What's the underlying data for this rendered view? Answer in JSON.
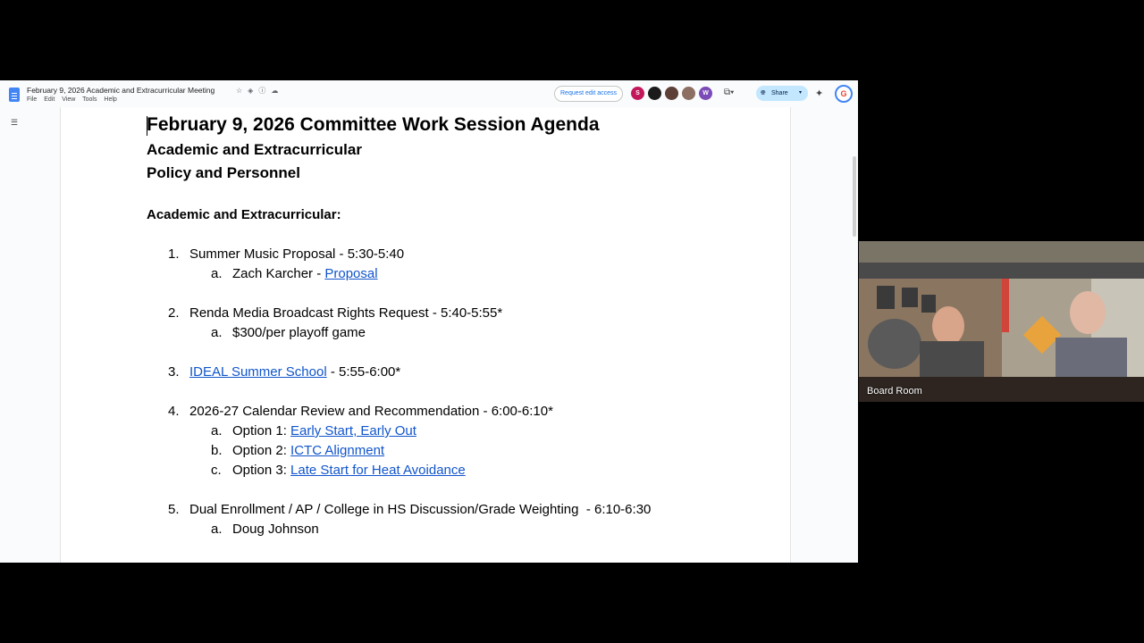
{
  "doc": {
    "title": "February 9, 2026 Academic and Extracurricular Meeting",
    "menu": [
      "File",
      "Edit",
      "View",
      "Tools",
      "Help"
    ],
    "request_edit_label": "Request edit access",
    "avatars": [
      {
        "letter": "S",
        "color": "#c2185b"
      },
      {
        "letter": "",
        "color": "#1b1b1b"
      },
      {
        "letter": "",
        "color": "#5d4037"
      },
      {
        "letter": "",
        "color": "#8d6e63"
      },
      {
        "letter": "W",
        "color": "#7b4bb7"
      }
    ],
    "share_label": "Share"
  },
  "content": {
    "heading": "February 9, 2026 Committee Work Session Agenda",
    "sub1": "Academic and Extracurricular",
    "sub2": "Policy and Personnel",
    "section": "Academic and Extracurricular:",
    "items": [
      {
        "num": "1.",
        "text": "Summer Music Proposal - 5:30-5:40"
      },
      {
        "letter": "a.",
        "text": "Zach Karcher - ",
        "link": "Proposal"
      },
      {
        "num": "2.",
        "text": "Renda Media Broadcast Rights Request - 5:40-5:55*"
      },
      {
        "letter": "a.",
        "text": "$300/per playoff game"
      },
      {
        "num": "3.",
        "link": "IDEAL Summer School",
        "text": " - 5:55-6:00*"
      },
      {
        "num": "4.",
        "text": "2026-27 Calendar Review and Recommendation - 6:00-6:10*"
      },
      {
        "letter": "a.",
        "text": "Option 1: ",
        "link": "Early Start, Early Out"
      },
      {
        "letter": "b.",
        "text": "Option 2: ",
        "link": "ICTC Alignment"
      },
      {
        "letter": "c.",
        "text": "Option 3: ",
        "link": "Late Start for Heat Avoidance"
      },
      {
        "num": "5.",
        "text": "Dual Enrollment / AP / College in HS Discussion/Grade Weighting  - 6:10-6:30"
      },
      {
        "letter": "a.",
        "text": "Doug Johnson"
      }
    ]
  },
  "video": {
    "participant_name": "Board Room"
  }
}
